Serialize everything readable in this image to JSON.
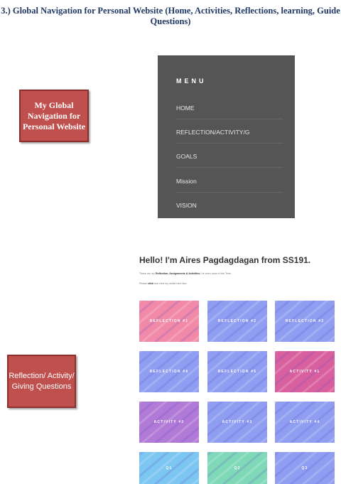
{
  "heading": "3.)  Global Navigation for Personal Website (Home, Activities, Reflections, learning, Guide Questions)",
  "label_global_nav": "My Global Navigation for Personal Website",
  "label_reflection": "Reflection/ Activity/ Giving Questions",
  "menu": {
    "title": "MENU",
    "items": [
      "HOME",
      "REFLECTION/ACTIVITY/G",
      "GOALS",
      "Mission",
      "VISION"
    ]
  },
  "site": {
    "title": "Hello! I'm Aires Pagdagdagan from SS191.",
    "line1_pre": "These are my ",
    "line1_bold": "Reflection, Assignments & Activities",
    "line1_post": " I've been done in this Term.",
    "line2_pre": "Please ",
    "line2_bold": "click",
    "line2_post": " and view my works here fam.",
    "cards": [
      {
        "label": "REFLECTION #1",
        "color": "#f08aa8"
      },
      {
        "label": "REFLECTION #2",
        "color": "#8f9ef0"
      },
      {
        "label": "REFLECTION #3",
        "color": "#8f9ef0"
      },
      {
        "label": "REFLECTION #4",
        "color": "#8f9ef0"
      },
      {
        "label": "REFLECTION #5",
        "color": "#8f9ef0"
      },
      {
        "label": "ACTIVITY #1",
        "color": "#d9609e"
      },
      {
        "label": "ACTIVITY #2",
        "color": "#b07ad6"
      },
      {
        "label": "ACTIVITY #3",
        "color": "#8f9ef0"
      },
      {
        "label": "ACTIVITY #4",
        "color": "#8f9ef0"
      },
      {
        "label": "Q1",
        "color": "#7cc6f2"
      },
      {
        "label": "Q2",
        "color": "#7fd9b8"
      },
      {
        "label": "Q3",
        "color": "#8f9ef0"
      }
    ]
  }
}
